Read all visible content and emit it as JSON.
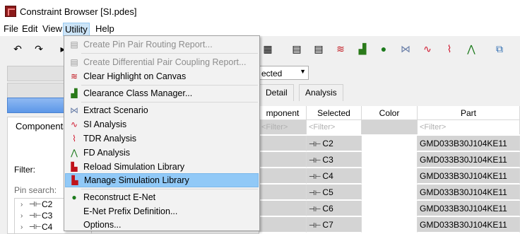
{
  "window": {
    "title": "Constraint Browser [SI.pdes]"
  },
  "menubar": {
    "items": [
      "File",
      "Edit",
      "View",
      "Utility",
      "Help"
    ]
  },
  "utility_menu": {
    "items": [
      {
        "label": "Create Pin Pair Routing Report...",
        "enabled": false,
        "icon": "report-icon"
      },
      {
        "label": "Create Differential Pair Coupling Report...",
        "enabled": false,
        "icon": "report-icon"
      },
      {
        "label": "Clear Highlight on Canvas",
        "enabled": true,
        "icon": "clear-highlight-icon"
      },
      {
        "label": "Clearance Class Manager...",
        "enabled": true,
        "icon": "clearance-icon"
      },
      {
        "label": "Extract Scenario",
        "enabled": true,
        "icon": "extract-icon"
      },
      {
        "label": "SI Analysis",
        "enabled": true,
        "icon": "si-analysis-icon"
      },
      {
        "label": "TDR Analysis",
        "enabled": true,
        "icon": "tdr-analysis-icon"
      },
      {
        "label": "FD Analysis",
        "enabled": true,
        "icon": "fd-analysis-icon"
      },
      {
        "label": "Reload Simulation Library",
        "enabled": true,
        "icon": "reload-library-icon"
      },
      {
        "label": "Manage Simulation Library",
        "enabled": true,
        "highlighted": true,
        "icon": "manage-library-icon"
      },
      {
        "label": "Reconstruct E-Net",
        "enabled": true,
        "icon": "enet-icon"
      },
      {
        "label": "E-Net Prefix Definition...",
        "enabled": true,
        "icon": ""
      },
      {
        "label": "Options...",
        "enabled": true,
        "icon": ""
      }
    ]
  },
  "left_panel": {
    "tab_label": "Components",
    "filter_label": "Filter:",
    "pin_search_label": "Pin search:",
    "tree_items": [
      "C2",
      "C3",
      "C4"
    ]
  },
  "right_panel": {
    "dropdown_value": "ected",
    "tabs": [
      "Detail",
      "Analysis"
    ],
    "columns": [
      "mponent",
      "Selected",
      "Color",
      "Part"
    ],
    "filter_placeholder": "<Filter>",
    "rows": [
      {
        "selected": "C2",
        "part": "GMD033B30J104KE11"
      },
      {
        "selected": "C3",
        "part": "GMD033B30J104KE11"
      },
      {
        "selected": "C4",
        "part": "GMD033B30J104KE11"
      },
      {
        "selected": "C5",
        "part": "GMD033B30J104KE11"
      },
      {
        "selected": "C6",
        "part": "GMD033B30J104KE11"
      },
      {
        "selected": "C7",
        "part": "GMD033B30J104KE11"
      }
    ]
  },
  "colors": {
    "highlight": "#91c9f7",
    "menu_active": "#cce4f7",
    "grid_gray": "#d4d4d4"
  }
}
